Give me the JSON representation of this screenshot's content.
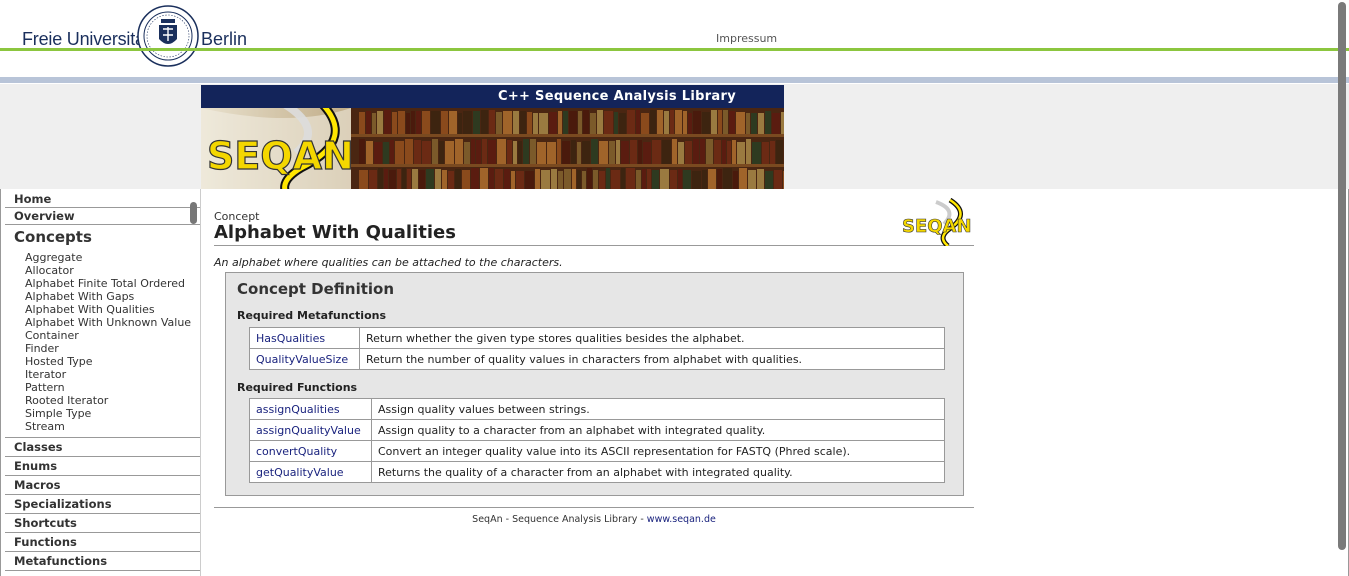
{
  "university": {
    "name_left": "Freie Universität",
    "name_right": "Berlin",
    "impressum_label": "Impressum"
  },
  "banner": {
    "title": "C++ Sequence Analysis Library",
    "logo_text": "SEQAN"
  },
  "sidebar": {
    "home_label": "Home",
    "overview_label": "Overview",
    "concepts_title": "Concepts",
    "concepts": [
      "Aggregate",
      "Allocator",
      "Alphabet Finite Total Ordered",
      "Alphabet With Gaps",
      "Alphabet With Qualities",
      "Alphabet With Unknown Value",
      "Container",
      "Finder",
      "Hosted Type",
      "Iterator",
      "Pattern",
      "Rooted Iterator",
      "Simple Type",
      "Stream"
    ],
    "sections": [
      "Classes",
      "Enums",
      "Macros",
      "Specializations",
      "Shortcuts",
      "Functions",
      "Metafunctions"
    ]
  },
  "main": {
    "kind": "Concept",
    "title": "Alphabet With Qualities",
    "logo_text": "SEQAN",
    "description": "An alphabet where qualities can be attached to the characters.",
    "definition": {
      "title": "Concept Definition",
      "metafunctions_label": "Required Metafunctions",
      "metafunctions": [
        {
          "name": "HasQualities",
          "desc": "Return whether the given type stores qualities besides the alphabet."
        },
        {
          "name": "QualityValueSize",
          "desc": "Return the number of quality values in characters from alphabet with qualities."
        }
      ],
      "functions_label": "Required Functions",
      "functions": [
        {
          "name": "assignQualities",
          "desc": "Assign quality values between strings."
        },
        {
          "name": "assignQualityValue",
          "desc": "Assign quality to a character from an alphabet with integrated quality."
        },
        {
          "name": "convertQuality",
          "desc": "Convert an integer quality value into its ASCII representation for FASTQ (Phred scale)."
        },
        {
          "name": "getQualityValue",
          "desc": "Returns the quality of a character from an alphabet with integrated quality."
        }
      ]
    }
  },
  "footer": {
    "text": "SeqAn - Sequence Analysis Library - ",
    "link": "www.seqan.de"
  },
  "colors": {
    "accent_green": "#8cc63f",
    "accent_blue": "#b8c4d8",
    "navy": "#13245a",
    "link": "#1a237e"
  }
}
